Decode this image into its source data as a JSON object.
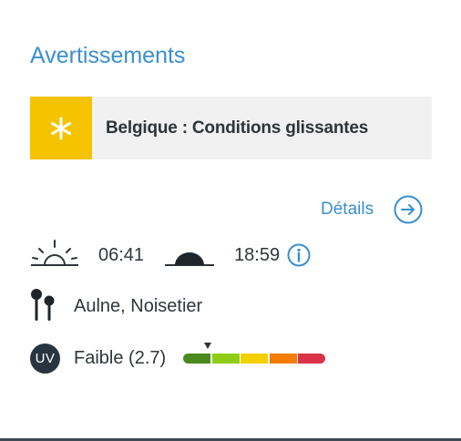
{
  "warnings": {
    "title": "Avertissements",
    "items": [
      {
        "text": "Belgique : Conditions glissantes",
        "icon": "snowflake-icon",
        "color": "#f5c300"
      }
    ]
  },
  "details": {
    "label": "Détails",
    "icon": "arrow-right-circle-icon"
  },
  "sun": {
    "sunrise_icon": "sunrise-icon",
    "sunrise": "06:41",
    "sunset_icon": "sunset-icon",
    "sunset": "18:59",
    "info_icon": "info-icon"
  },
  "pollen": {
    "icon": "pollen-icon",
    "text": "Aulne, Noisetier"
  },
  "uv": {
    "badge": "UV",
    "text": "Faible (2.7)",
    "value": 2.7,
    "segments": [
      {
        "color": "#4a8a1f"
      },
      {
        "color": "#8fcc14"
      },
      {
        "color": "#f5d000"
      },
      {
        "color": "#f57c00"
      },
      {
        "color": "#d9334a"
      }
    ]
  },
  "colors": {
    "accent": "#3a8fd0",
    "warning_yellow": "#f5c300",
    "text": "#2f363b"
  }
}
